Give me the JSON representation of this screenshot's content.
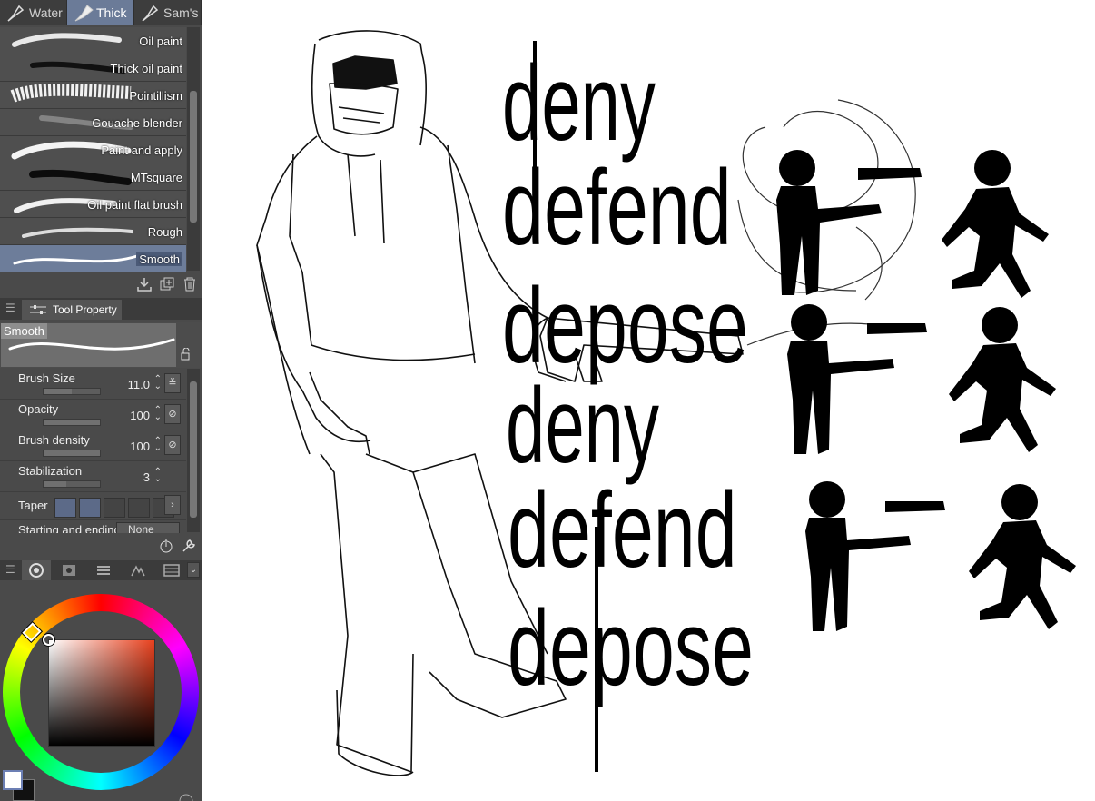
{
  "brush_group_tabs": [
    {
      "label": "Water",
      "active": false,
      "icon": "pen-nib-icon"
    },
    {
      "label": "Thick",
      "active": true,
      "icon": "paint-tube-icon"
    },
    {
      "label": "Sam's",
      "active": false,
      "icon": "pen-nib-icon"
    }
  ],
  "brushes": [
    {
      "label": "Oil paint"
    },
    {
      "label": "Thick oil paint"
    },
    {
      "label": "Pointillism"
    },
    {
      "label": "Gouache blender"
    },
    {
      "label": "Paint and apply"
    },
    {
      "label": "MTsquare"
    },
    {
      "label": "Oil paint flat brush"
    },
    {
      "label": "Rough"
    },
    {
      "label": "Smooth",
      "selected": true
    }
  ],
  "brush_actions": [
    "download-icon",
    "duplicate-icon",
    "trash-icon"
  ],
  "tool_property": {
    "tab_label": "Tool Property",
    "brush_name": "Smooth",
    "properties": [
      {
        "label": "Brush Size",
        "value": "11.0",
        "level": 0.5
      },
      {
        "label": "Opacity",
        "value": "100",
        "level": 1.0
      },
      {
        "label": "Brush density",
        "value": "100",
        "level": 1.0
      },
      {
        "label": "Stabilization",
        "value": "3",
        "level": 0.4
      }
    ],
    "taper_label": "Taper",
    "starting_label": "Starting and ending",
    "starting_value": "None"
  },
  "color": {
    "main": "#ffffff",
    "sub": "#111111",
    "hue": "#e8411e"
  },
  "canvas_text": {
    "deny": "deny",
    "defend": "defend",
    "depose": "depose"
  }
}
